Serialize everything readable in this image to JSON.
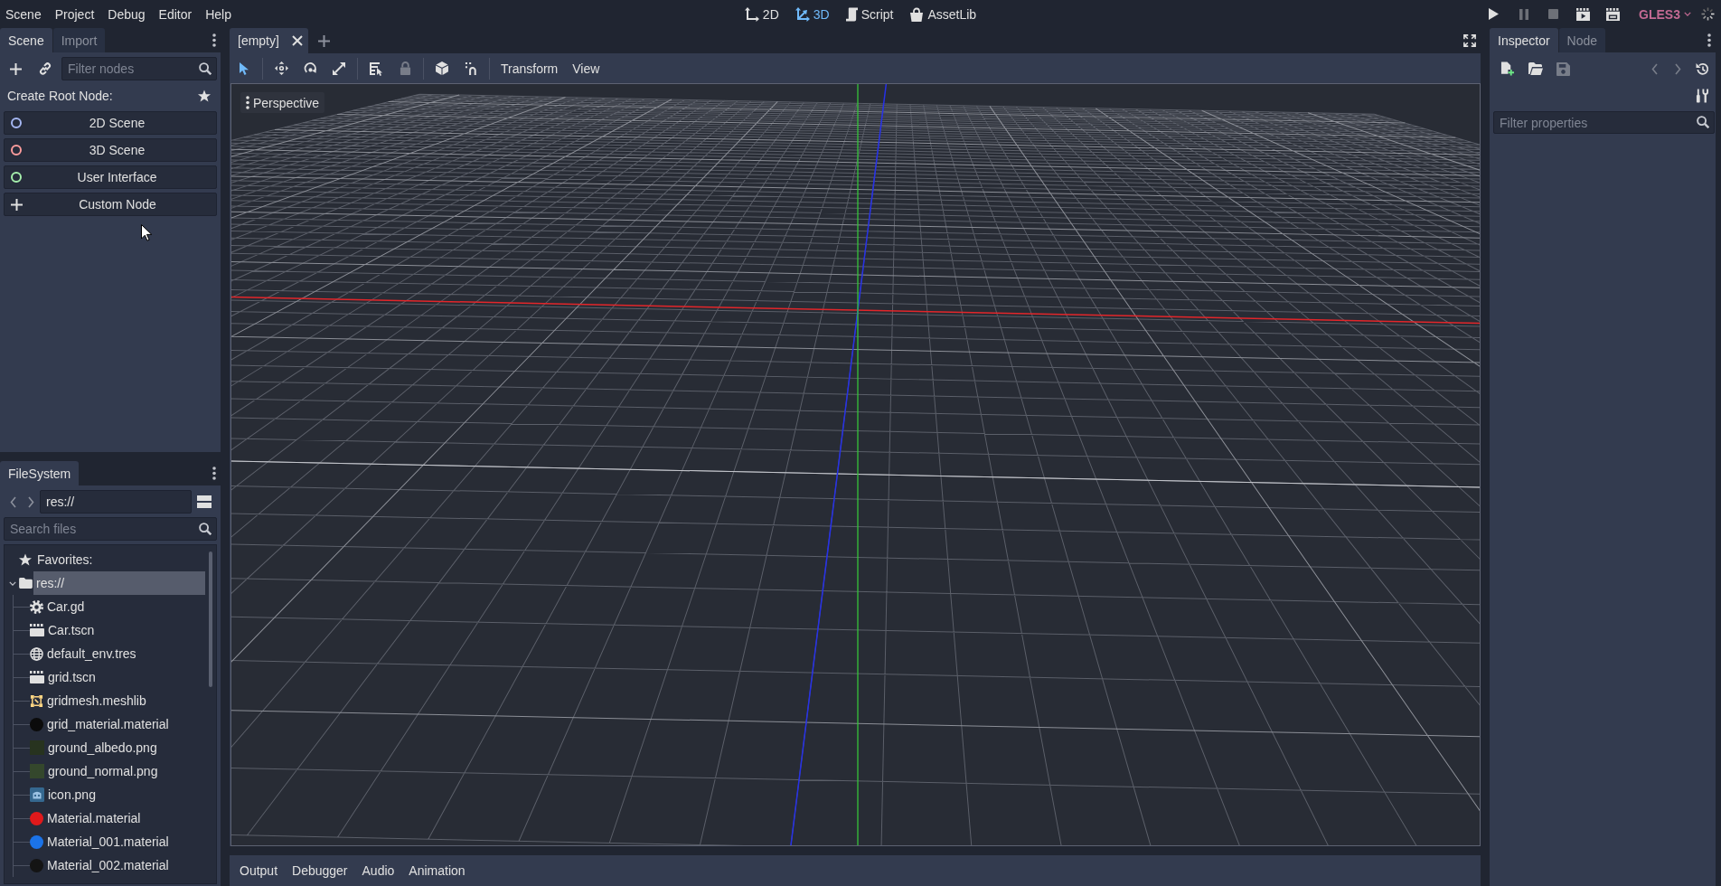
{
  "menu_bar": {
    "items": [
      "Scene",
      "Project",
      "Debug",
      "Editor",
      "Help"
    ]
  },
  "workspaces": [
    {
      "label": "2D",
      "kind": "planar",
      "selected": false
    },
    {
      "label": "3D",
      "kind": "spatial",
      "selected": true
    },
    {
      "label": "Script",
      "kind": "script",
      "selected": false
    },
    {
      "label": "AssetLib",
      "kind": "assetlib",
      "selected": false
    }
  ],
  "run_controls": [
    {
      "kind": "play",
      "disabled": false
    },
    {
      "kind": "pause",
      "disabled": true
    },
    {
      "kind": "stop",
      "disabled": true
    },
    {
      "kind": "play_scene",
      "disabled": false
    },
    {
      "kind": "play_custom",
      "disabled": false
    }
  ],
  "renderer": "GLES3",
  "scene_dock": {
    "tabs": [
      {
        "label": "Scene",
        "selected": true
      },
      {
        "label": "Import",
        "selected": false
      }
    ],
    "filter": {
      "placeholder": "Filter nodes"
    },
    "heading": "Create Root Node:",
    "root_options": [
      {
        "label": "2D Scene",
        "kind": "ring",
        "color": "#a5b7f3"
      },
      {
        "label": "3D Scene",
        "kind": "ring",
        "color": "#fc9c9c"
      },
      {
        "label": "User Interface",
        "kind": "ring",
        "color": "#a5efac"
      },
      {
        "label": "Custom Node",
        "kind": "plus"
      }
    ]
  },
  "filesystem_dock": {
    "tabs": [
      {
        "label": "FileSystem",
        "selected": true
      }
    ],
    "path": "res://",
    "search": {
      "placeholder": "Search files"
    },
    "favorites": "Favorites:",
    "tree": [
      {
        "label": "res://",
        "kind": "folder",
        "expanded": true,
        "selected": true,
        "children": [
          {
            "label": "Car.gd",
            "kind": "script",
            "selected": false
          },
          {
            "label": "Car.tscn",
            "kind": "scene",
            "selected": false
          },
          {
            "label": "default_env.tres",
            "kind": "environment",
            "selected": false
          },
          {
            "label": "grid.tscn",
            "kind": "scene",
            "selected": false
          },
          {
            "label": "gridmesh.meshlib",
            "kind": "meshlib",
            "selected": false
          },
          {
            "label": "grid_material.material",
            "kind": "material",
            "color": "#0b0b0b",
            "selected": false
          },
          {
            "label": "ground_albedo.png",
            "kind": "image",
            "color": "#27331f",
            "selected": false
          },
          {
            "label": "ground_normal.png",
            "kind": "image",
            "color": "#34472c",
            "selected": false
          },
          {
            "label": "icon.png",
            "kind": "thumbnail",
            "selected": false
          },
          {
            "label": "Material.material",
            "kind": "material",
            "color": "#e0191b",
            "selected": false
          },
          {
            "label": "Material_001.material",
            "kind": "material",
            "color": "#1b73e8",
            "selected": false
          },
          {
            "label": "Material_002.material",
            "kind": "material",
            "color": "#141414",
            "selected": false
          }
        ]
      }
    ]
  },
  "editor_tabs": [
    {
      "label": "[empty]",
      "selected": true
    }
  ],
  "viewport_toolbar": {
    "groups": [
      [
        {
          "kind": "select",
          "selected": true,
          "disabled": false
        }
      ],
      [
        {
          "kind": "move",
          "selected": false,
          "disabled": false
        },
        {
          "kind": "rotate",
          "selected": false,
          "disabled": false
        },
        {
          "kind": "scale",
          "selected": false,
          "disabled": false
        }
      ],
      [
        {
          "kind": "list_select",
          "selected": false,
          "disabled": false
        },
        {
          "kind": "lock",
          "selected": false,
          "disabled": true
        }
      ],
      [
        {
          "kind": "local_space",
          "selected": false,
          "disabled": false
        },
        {
          "kind": "snap",
          "selected": false,
          "disabled": false
        }
      ]
    ],
    "menus": [
      "Transform",
      "View"
    ]
  },
  "viewport": {
    "view_menu": "Perspective"
  },
  "bottom_panel": {
    "tabs": [
      {
        "label": "Output",
        "selected": false
      },
      {
        "label": "Debugger",
        "selected": false
      },
      {
        "label": "Audio",
        "selected": false
      },
      {
        "label": "Animation",
        "selected": false
      }
    ]
  },
  "inspector_dock": {
    "tabs": [
      {
        "label": "Inspector",
        "selected": true
      },
      {
        "label": "Node",
        "selected": false
      }
    ],
    "tool_rows": [
      [
        {
          "kind": "new_resource",
          "disabled": false
        },
        {
          "kind": "open",
          "disabled": false
        },
        {
          "kind": "save",
          "disabled": true
        },
        {
          "kind": "back",
          "disabled": true
        },
        {
          "kind": "forward",
          "disabled": true
        },
        {
          "kind": "history",
          "disabled": false
        }
      ],
      [
        {
          "kind": "object_tools",
          "disabled": false
        }
      ]
    ],
    "filter": {
      "placeholder": "Filter properties"
    }
  }
}
